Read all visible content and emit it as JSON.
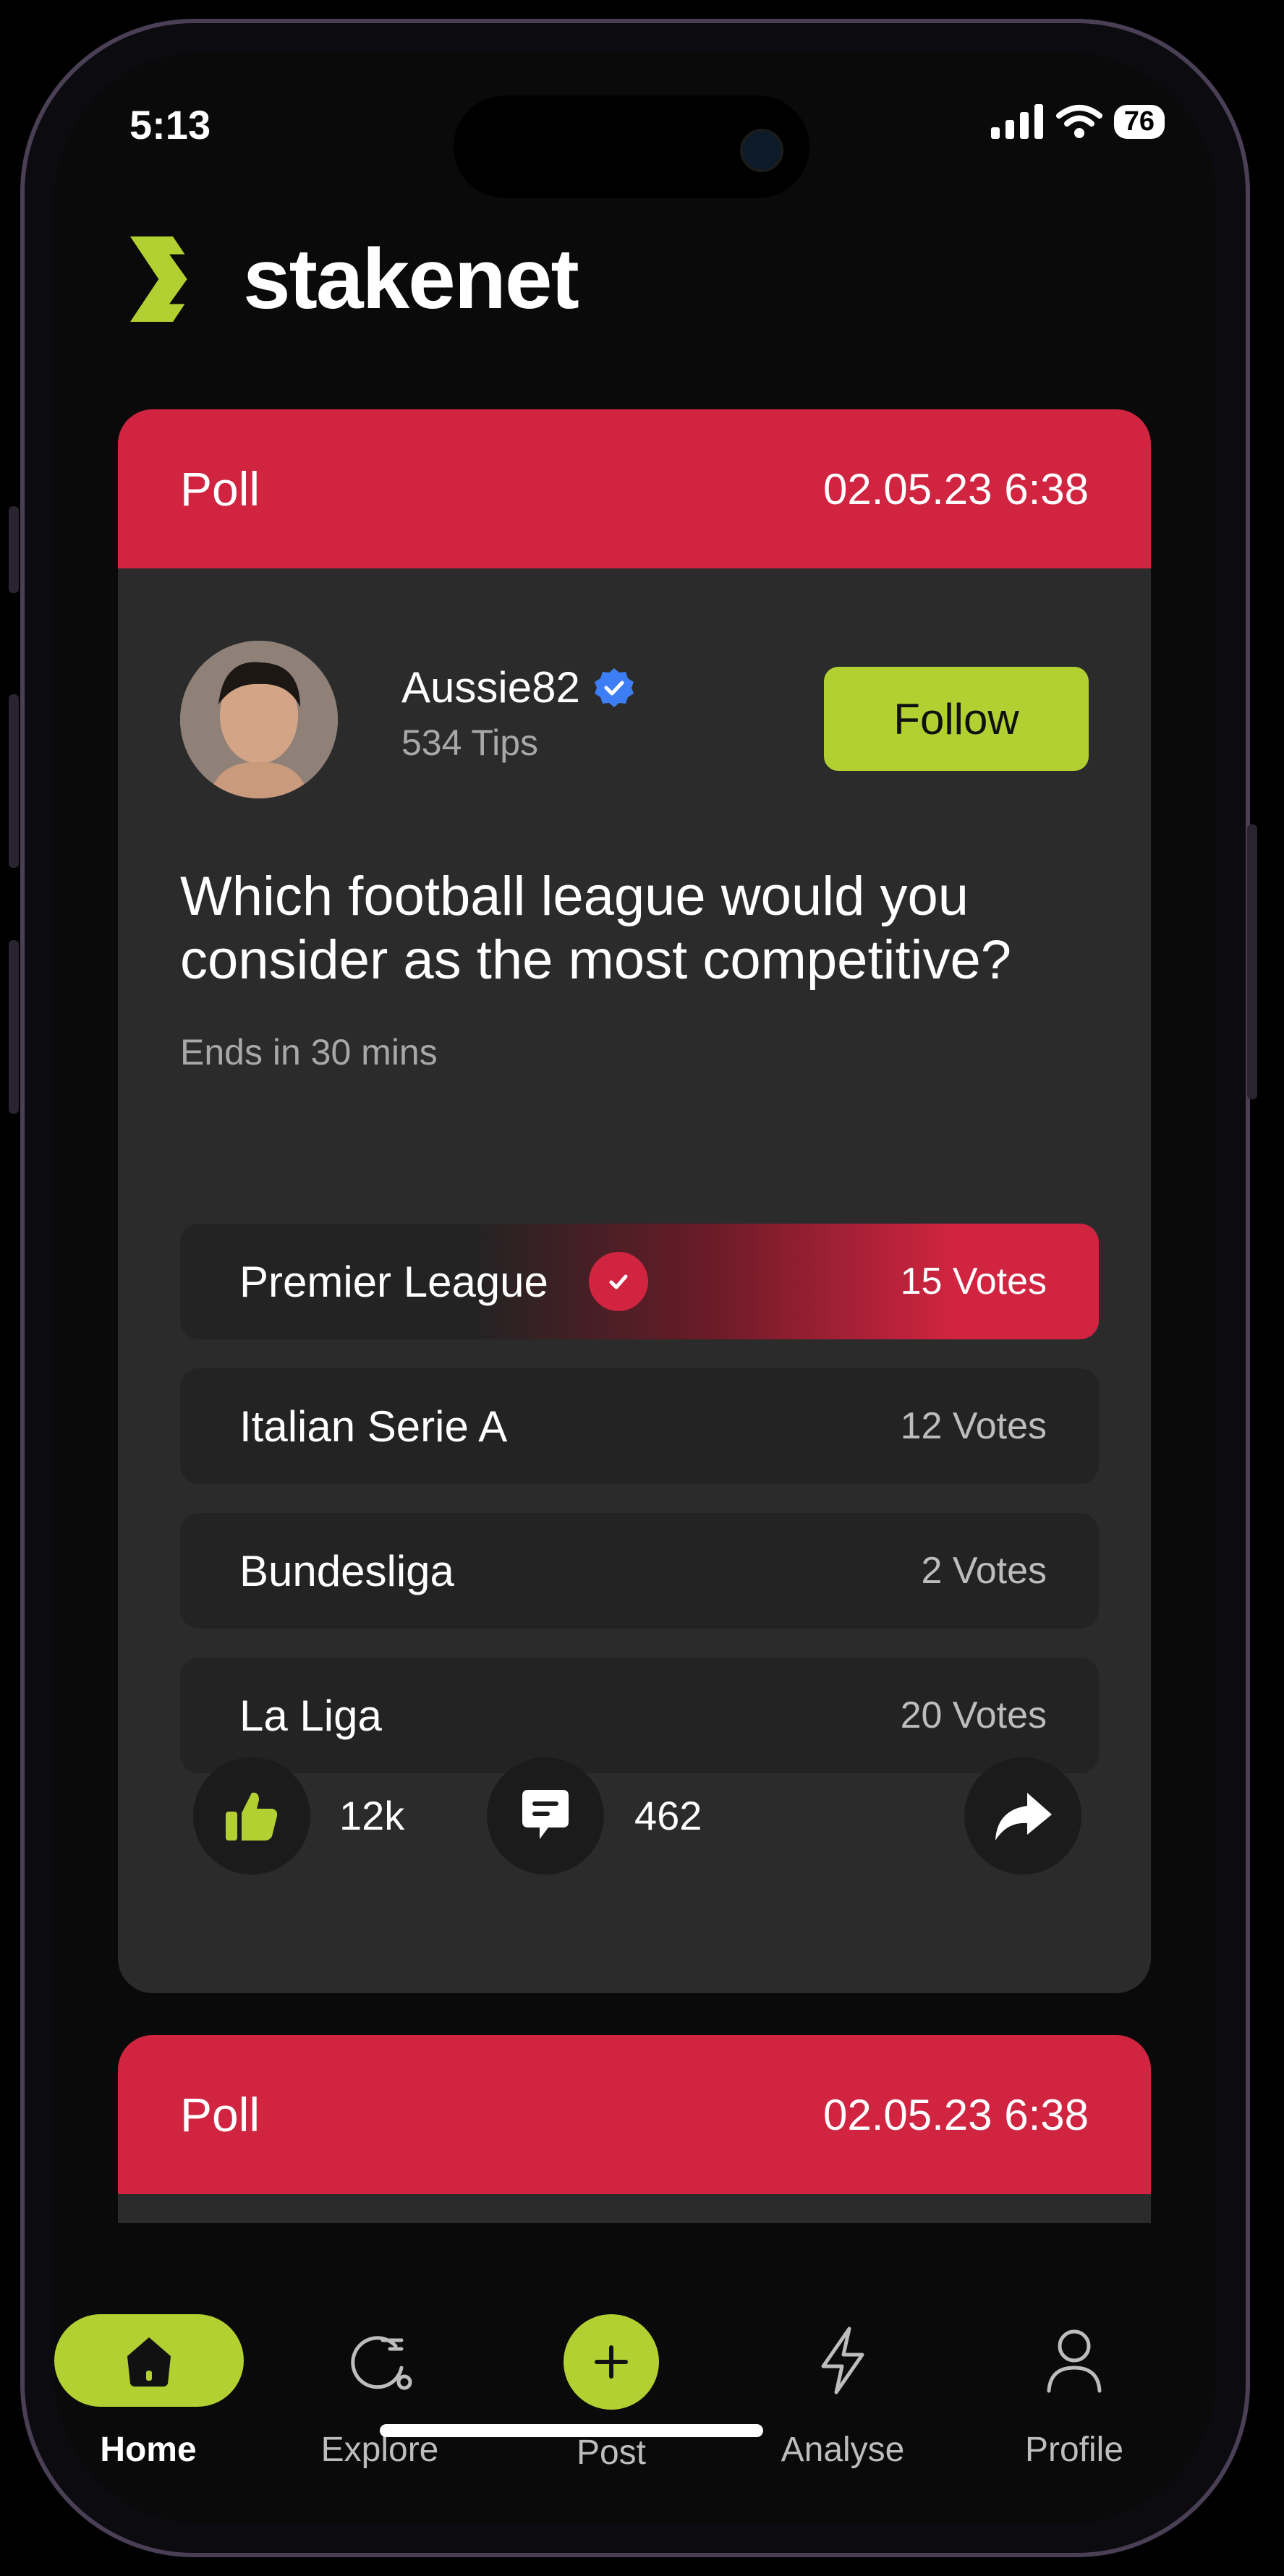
{
  "status_bar": {
    "time": "5:13",
    "battery": "76"
  },
  "brand": {
    "name": "stakenet"
  },
  "poll_card": {
    "label": "Poll",
    "date": "02.05.23 6:38",
    "user": {
      "name": "Aussie82",
      "tips": "534 Tips",
      "follow_label": "Follow"
    },
    "question": "Which football league would you consider as the most competitive?",
    "ends_in": "Ends in 30 mins",
    "options": [
      {
        "label": "Premier League",
        "votes": "15 Votes",
        "selected": true
      },
      {
        "label": "Italian Serie A",
        "votes": "12 Votes",
        "selected": false
      },
      {
        "label": "Bundesliga",
        "votes": "2 Votes",
        "selected": false
      },
      {
        "label": "La Liga",
        "votes": "20 Votes",
        "selected": false
      }
    ],
    "likes": "12k",
    "comments": "462"
  },
  "next_card": {
    "label": "Poll",
    "date": "02.05.23 6:38"
  },
  "bottom_nav": {
    "items": [
      {
        "label": "Home",
        "icon": "home-icon"
      },
      {
        "label": "Explore",
        "icon": "explore-icon"
      },
      {
        "label": "Post",
        "icon": "plus-icon"
      },
      {
        "label": "Analyse",
        "icon": "lightning-icon"
      },
      {
        "label": "Profile",
        "icon": "person-icon"
      }
    ]
  },
  "colors": {
    "accent_red": "#d02440",
    "accent_lime": "#b3d032",
    "card_bg": "#2b2b2b",
    "background": "#0a0a0a"
  }
}
